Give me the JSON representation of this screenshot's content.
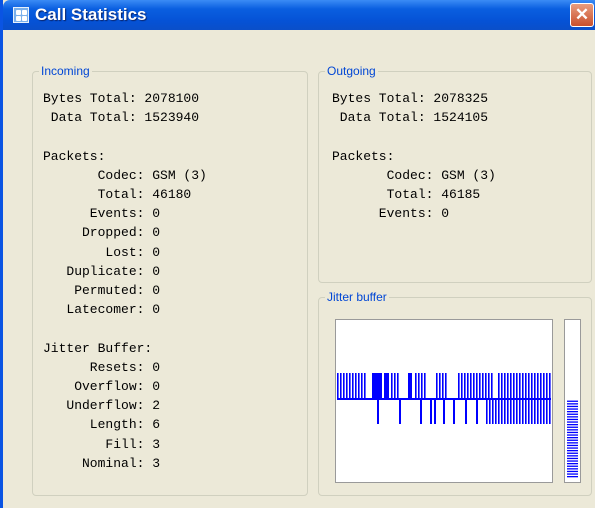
{
  "window": {
    "title": "Call Statistics",
    "close_glyph": "✕",
    "title_icon": "app-icon"
  },
  "incoming": {
    "legend": "Incoming",
    "lines": [
      "Bytes Total: 2078100",
      " Data Total: 1523940",
      "",
      "Packets:",
      "       Codec: GSM (3)",
      "       Total: 46180",
      "      Events: 0",
      "     Dropped: 0",
      "        Lost: 0",
      "   Duplicate: 0",
      "    Permuted: 0",
      "   Latecomer: 0",
      "",
      "Jitter Buffer:",
      "      Resets: 0",
      "    Overflow: 0",
      "   Underflow: 2",
      "      Length: 6",
      "        Fill: 3",
      "     Nominal: 3"
    ]
  },
  "outgoing": {
    "legend": "Outgoing",
    "lines": [
      "Bytes Total: 2078325",
      " Data Total: 1524105",
      "",
      "Packets:",
      "       Codec: GSM (3)",
      "       Total: 46185",
      "      Events: 0"
    ]
  },
  "jitter_buffer": {
    "legend": "Jitter buffer",
    "accent_color": "#0000ff",
    "meter_fill_fraction": 0.5
  }
}
